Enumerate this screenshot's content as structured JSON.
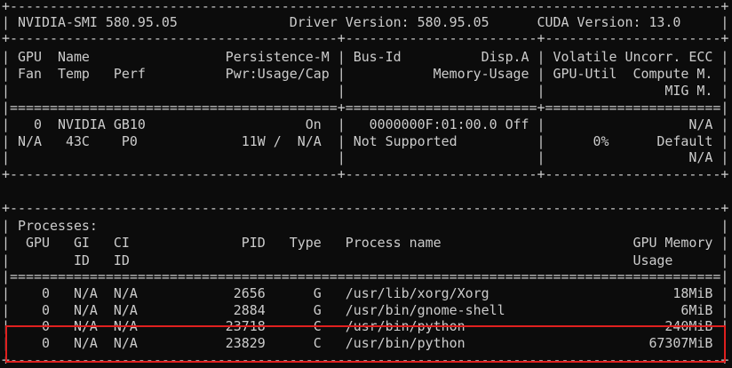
{
  "terminal": {
    "lines": [
      "+-----------------------------------------------------------------------------------------+",
      "| NVIDIA-SMI 580.95.05              Driver Version: 580.95.05      CUDA Version: 13.0     |",
      "+-----------------------------------------+------------------------+----------------------+",
      "| GPU  Name                 Persistence-M | Bus-Id          Disp.A | Volatile Uncorr. ECC |",
      "| Fan  Temp   Perf          Pwr:Usage/Cap |           Memory-Usage | GPU-Util  Compute M. |",
      "|                                         |                        |               MIG M. |",
      "|=========================================+========================+======================|",
      "|   0  NVIDIA GB10                    On  |   0000000F:01:00.0 Off |                  N/A |",
      "| N/A   43C    P0             11W /  N/A  | Not Supported          |      0%      Default |",
      "|                                         |                        |                  N/A |",
      "+-----------------------------------------+------------------------+----------------------+",
      "",
      "+-----------------------------------------------------------------------------------------+",
      "| Processes:                                                                              |",
      "|  GPU   GI   CI              PID   Type   Process name                        GPU Memory |",
      "|        ID   ID                                                               Usage      |",
      "|=========================================================================================|",
      "|    0   N/A  N/A            2656      G   /usr/lib/xorg/Xorg                       18MiB |",
      "|    0   N/A  N/A            2884      G   /usr/bin/gnome-shell                      6MiB |",
      "|    0   N/A  N/A           23718      C   /usr/bin/python                         240MiB |",
      "|    0   N/A  N/A           23829      C   /usr/bin/python                       67307MiB |",
      "+-----------------------------------------------------------------------------------------+"
    ]
  },
  "colors": {
    "background": "#0c0c0c",
    "text": "#cccccc",
    "highlight": "#e0201f"
  }
}
